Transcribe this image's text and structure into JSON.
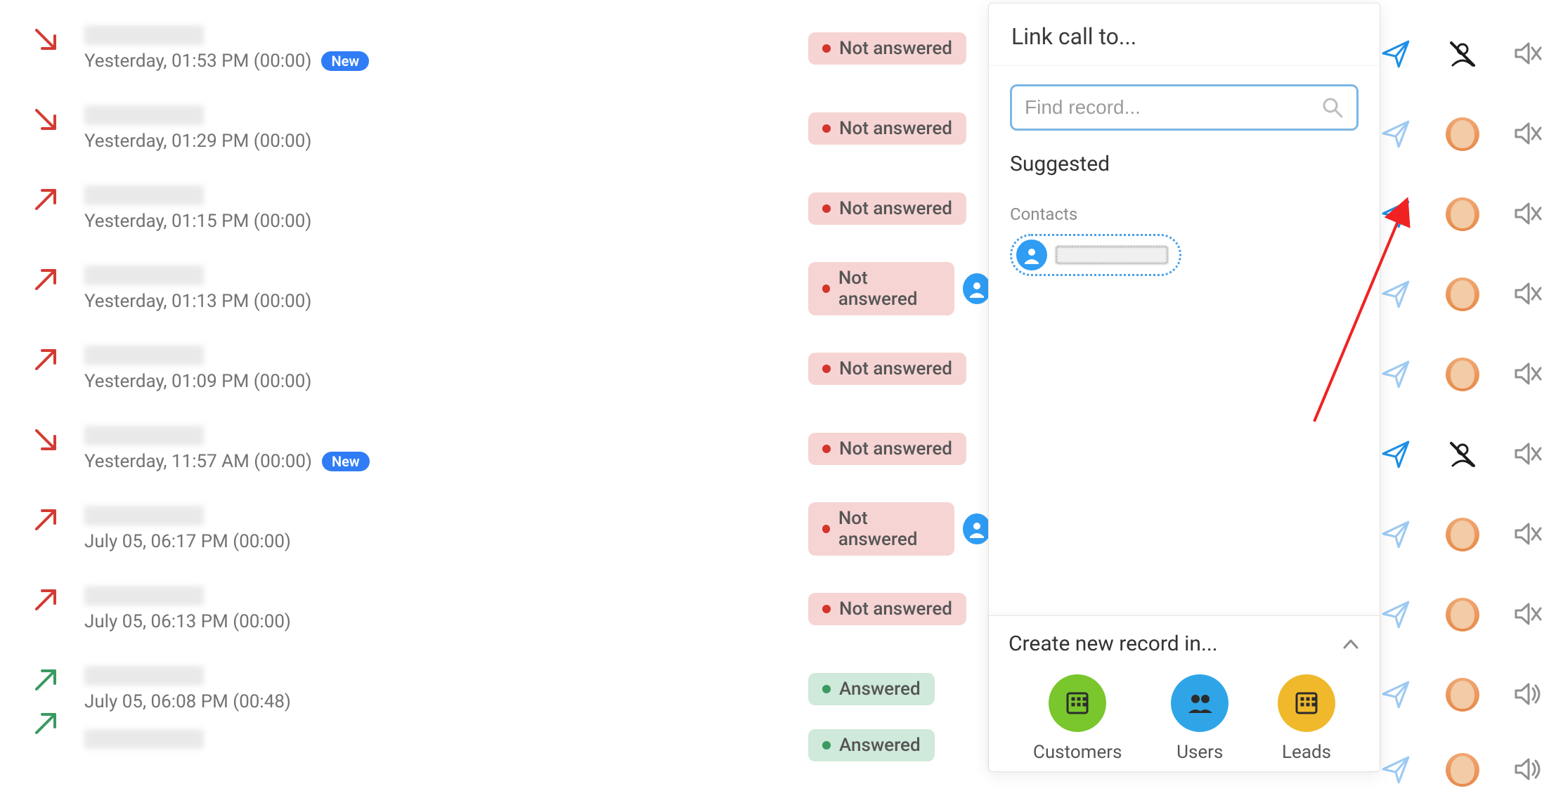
{
  "badges": {
    "new": "New"
  },
  "status": {
    "not_answered": "Not answered",
    "answered": "Answered"
  },
  "calls": [
    {
      "time": "Yesterday, 01:53 PM (00:00)",
      "dir": "in-missed",
      "status": "not_answered",
      "new": true,
      "user": "none"
    },
    {
      "time": "Yesterday, 01:29 PM (00:00)",
      "dir": "in-missed",
      "status": "not_answered",
      "new": false,
      "user": "avatar"
    },
    {
      "time": "Yesterday, 01:15 PM (00:00)",
      "dir": "out-missed",
      "status": "not_answered",
      "new": false,
      "user": "avatar"
    },
    {
      "time": "Yesterday, 01:13 PM (00:00)",
      "dir": "out-missed",
      "status": "not_answered",
      "new": false,
      "user": "avatar",
      "contact": true
    },
    {
      "time": "Yesterday, 01:09 PM (00:00)",
      "dir": "out-missed",
      "status": "not_answered",
      "new": false,
      "user": "avatar"
    },
    {
      "time": "Yesterday, 11:57 AM (00:00)",
      "dir": "in-missed",
      "status": "not_answered",
      "new": true,
      "user": "none"
    },
    {
      "time": "July 05, 06:17 PM (00:00)",
      "dir": "out-missed",
      "status": "not_answered",
      "new": false,
      "user": "avatar",
      "contact": true
    },
    {
      "time": "July 05, 06:13 PM (00:00)",
      "dir": "out-missed",
      "status": "not_answered",
      "new": false,
      "user": "avatar"
    },
    {
      "time": "July 05, 06:08 PM (00:48)",
      "dir": "in-ok",
      "status": "answered",
      "new": false,
      "user": "avatar",
      "sound": "on"
    },
    {
      "time": "",
      "dir": "in-ok",
      "status": "answered",
      "new": false,
      "user": "avatar",
      "sound": "on",
      "partial": true
    }
  ],
  "popup": {
    "title": "Link call to...",
    "search_placeholder": "Find record...",
    "suggested": "Suggested",
    "contacts_label": "Contacts",
    "create_title": "Create new record in...",
    "create_items": {
      "customers": "Customers",
      "users": "Users",
      "leads": "Leads"
    }
  },
  "colors": {
    "link_blue": "#4aa7e8",
    "missed_red": "#d43a33",
    "ok_green": "#3a9a62"
  }
}
